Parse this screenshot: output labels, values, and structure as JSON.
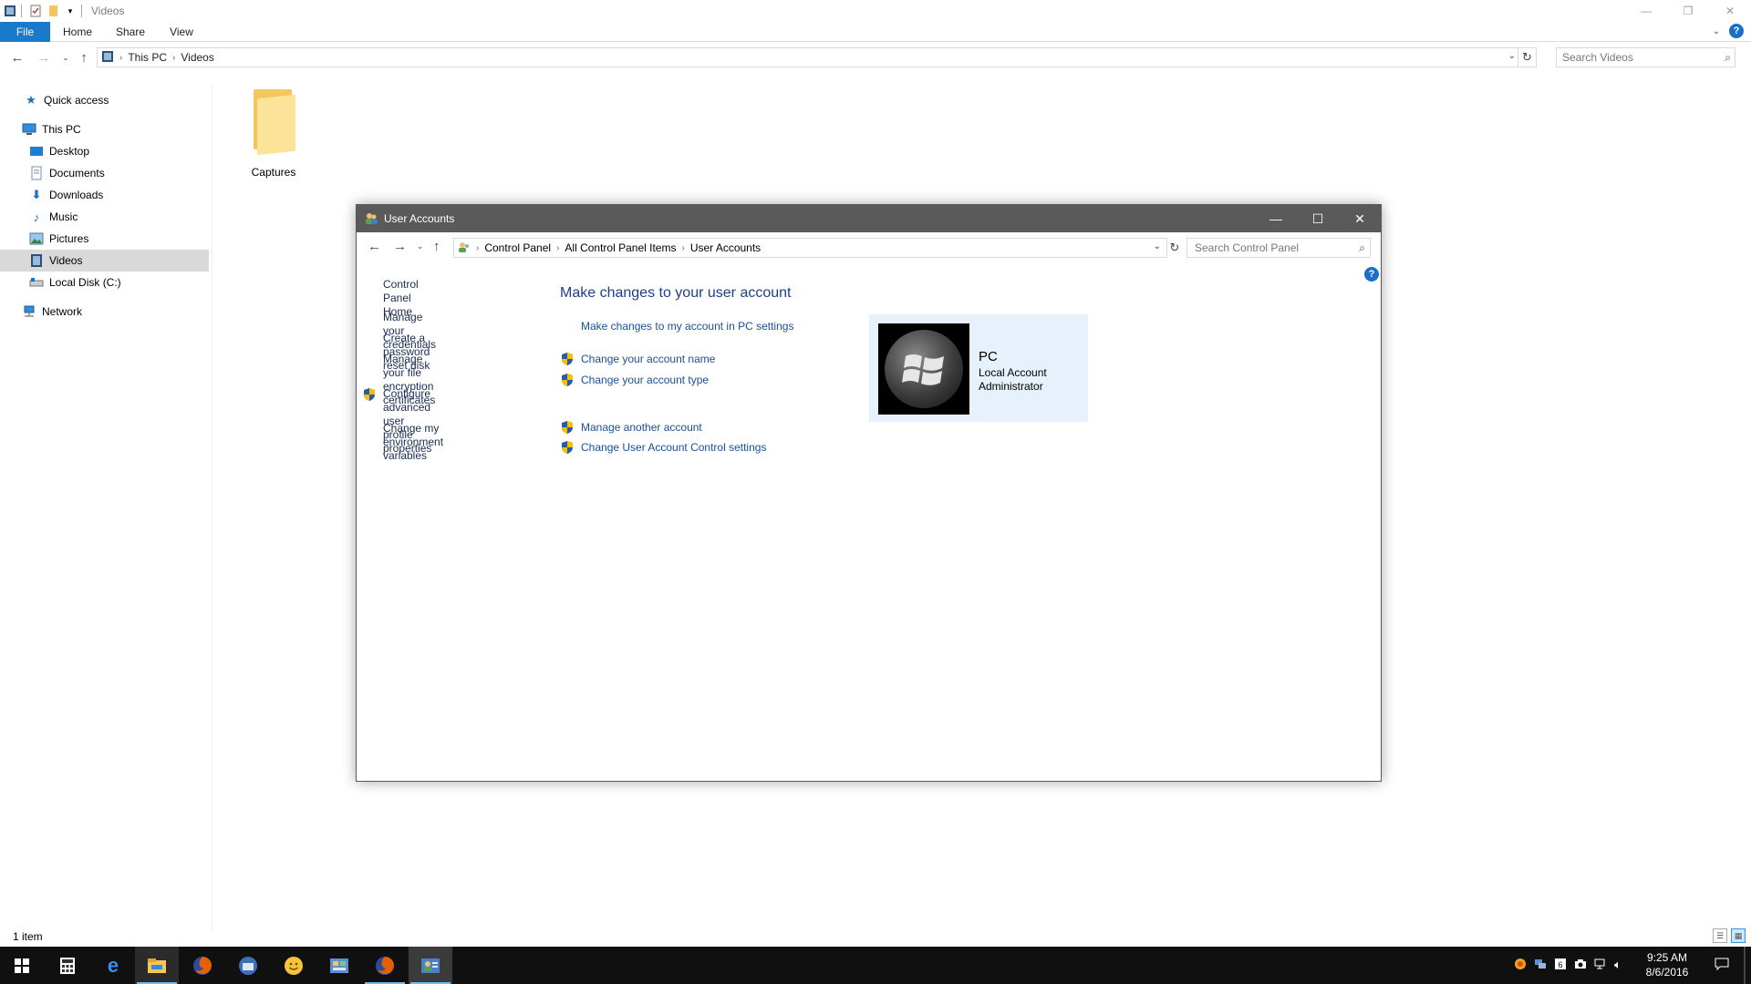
{
  "explorer": {
    "title": "Videos",
    "tabs": [
      "File",
      "Home",
      "Share",
      "View"
    ],
    "address": [
      "This PC",
      "Videos"
    ],
    "search_placeholder": "Search Videos",
    "nav": {
      "quick_access": "Quick access",
      "this_pc": "This PC",
      "desktop": "Desktop",
      "documents": "Documents",
      "downloads": "Downloads",
      "music": "Music",
      "pictures": "Pictures",
      "videos": "Videos",
      "local_disk": "Local Disk (C:)",
      "network": "Network"
    },
    "folder_name": "Captures",
    "item_count": "1 item"
  },
  "user_accounts": {
    "title": "User Accounts",
    "address": [
      "Control Panel",
      "All Control Panel Items",
      "User Accounts"
    ],
    "search_placeholder": "Search Control Panel",
    "sidebar": {
      "home": "Control Panel Home",
      "credentials": "Manage your credentials",
      "reset_disk": "Create a password reset disk",
      "encryption_1": "Manage your file encryption",
      "encryption_2": "certificates",
      "advanced_1": "Configure advanced user",
      "advanced_2": "profile properties",
      "env_1": "Change my environment",
      "env_2": "variables"
    },
    "heading": "Make changes to your user account",
    "tasks": {
      "pc_settings": "Make changes to my account in PC settings",
      "change_name": "Change your account name",
      "change_type": "Change your account type",
      "manage_other": "Manage another account",
      "uac": "Change User Account Control settings"
    },
    "account": {
      "name": "PC",
      "type": "Local Account",
      "role": "Administrator"
    }
  },
  "taskbar": {
    "time": "9:25 AM",
    "date": "8/6/2016"
  },
  "colors": {
    "accent": "#1979ca",
    "link": "#1a4f9c",
    "heading": "#1e3e8c",
    "dialog_title": "#5a5a5a",
    "account_card": "#e7f1fb",
    "taskbar": "#101010"
  }
}
